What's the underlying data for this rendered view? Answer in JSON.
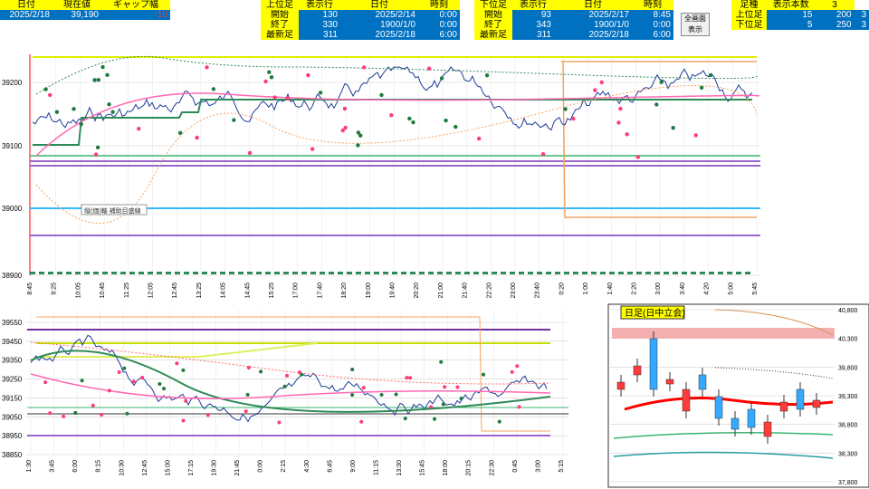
{
  "header": {
    "g1": [
      [
        "日付",
        "現在値",
        "ギャップ幅"
      ],
      [
        "2025/2/18",
        "39,190",
        "-10"
      ]
    ],
    "g2": [
      [
        "上位足",
        "表示行",
        "日付",
        "時刻"
      ],
      [
        "開始",
        "130",
        "2025/2/14",
        "0:00"
      ],
      [
        "終了",
        "330",
        "1900/1/0",
        "0:00"
      ],
      [
        "最新足",
        "311",
        "2025/2/18",
        "6:00"
      ]
    ],
    "g3": [
      [
        "下位足",
        "表示行",
        "日付",
        "時刻"
      ],
      [
        "開始",
        "93",
        "2025/2/17",
        "8:45"
      ],
      [
        "終了",
        "343",
        "1900/1/0",
        "0:00"
      ],
      [
        "最新足",
        "311",
        "2025/2/18",
        "6:00"
      ]
    ],
    "button_label": "全画面\n表示",
    "g4": [
      [
        "足種",
        "表示本数",
        "3"
      ],
      [
        "上位足",
        "15",
        "200",
        "3"
      ],
      [
        "下位足",
        "5",
        "250",
        "3"
      ]
    ]
  },
  "top_chart": {
    "yticks": [
      "39200",
      "39100",
      "39000",
      "38900"
    ],
    "xticks": [
      "8:45",
      "9:25",
      "10:05",
      "10:45",
      "11:25",
      "12:05",
      "12:45",
      "13:25",
      "14:05",
      "14:45",
      "15:25",
      "17:00",
      "17:40",
      "18:20",
      "19:00",
      "19:40",
      "20:20",
      "21:00",
      "21:40",
      "22:20",
      "23:00",
      "23:40",
      "0:20",
      "1:00",
      "1:40",
      "2:20",
      "3:00",
      "3:40",
      "4:20",
      "5:00",
      "5:45"
    ],
    "annotation": "縦(価)軸 補助目盛線"
  },
  "bottom_chart": {
    "yticks": [
      "39550",
      "39450",
      "39350",
      "39250",
      "39150",
      "39050",
      "38950",
      "38850"
    ],
    "xticks": [
      "1:30",
      "3:45",
      "6:00",
      "8:15",
      "10:30",
      "12:45",
      "15:00",
      "17:15",
      "19:30",
      "21:45",
      "0:00",
      "2:15",
      "4:30",
      "6:45",
      "9:00",
      "11:15",
      "13:30",
      "15:45",
      "18:00",
      "20:15",
      "22:30",
      "0:45",
      "3:00",
      "5:15"
    ]
  },
  "inset_chart": {
    "title": "日足(日中立会)",
    "yticks": [
      "40,800",
      "40,300",
      "39,800",
      "39,300",
      "38,800",
      "38,300",
      "37,800"
    ]
  },
  "colors": {
    "grid_blue": "#0070c0",
    "grid_yellow": "#ffff00",
    "gain": "#ff3b3b"
  }
}
